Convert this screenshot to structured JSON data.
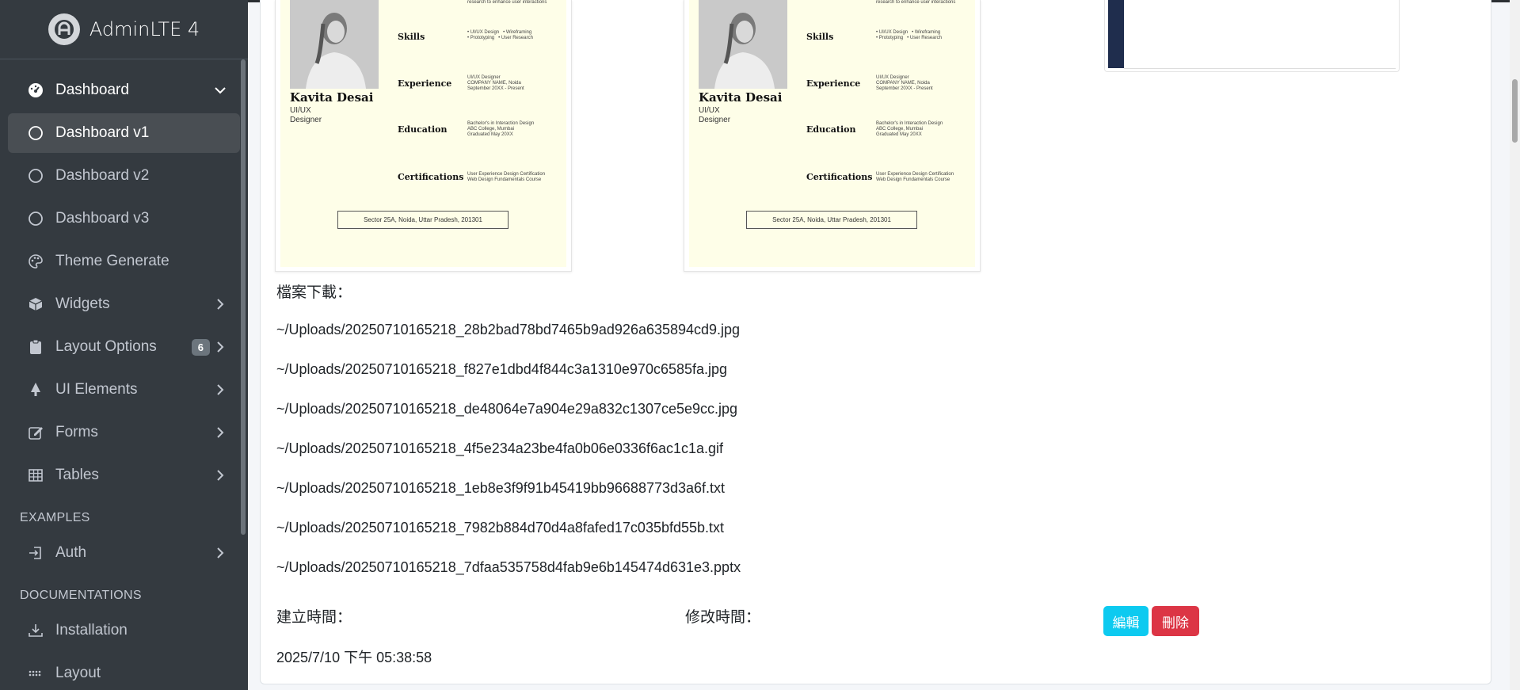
{
  "brand": {
    "name": "AdminLTE 4",
    "logo_icon": "adminlte-logo-icon"
  },
  "sidebar": {
    "items": [
      {
        "label": "Dashboard",
        "icon": "speedometer-icon",
        "chevron": "down"
      },
      {
        "label": "Dashboard v1",
        "icon": "circle-icon"
      },
      {
        "label": "Dashboard v2",
        "icon": "circle-icon"
      },
      {
        "label": "Dashboard v3",
        "icon": "circle-icon"
      },
      {
        "label": "Theme Generate",
        "icon": "palette-icon"
      },
      {
        "label": "Widgets",
        "icon": "box-icon",
        "chevron": "right"
      },
      {
        "label": "Layout Options",
        "icon": "clipboard-icon",
        "badge": "6",
        "chevron": "right"
      },
      {
        "label": "UI Elements",
        "icon": "tree-icon",
        "chevron": "right"
      },
      {
        "label": "Forms",
        "icon": "pencil-square-icon",
        "chevron": "right"
      },
      {
        "label": "Tables",
        "icon": "table-icon",
        "chevron": "right"
      }
    ],
    "header_examples": "EXAMPLES",
    "auth": {
      "label": "Auth",
      "icon": "login-icon"
    },
    "header_docs": "DOCUMENTATIONS",
    "installation": {
      "label": "Installation",
      "icon": "download-icon"
    },
    "layout": {
      "label": "Layout",
      "icon": "grip-icon"
    }
  },
  "resume": {
    "name": "Kavita Desai",
    "role": "UI/UX Designer",
    "top_text": "research to enhance user interactions",
    "skills_title": "Skills",
    "skills_text": "• UI/UX Design   • Wireframing\n• Prototyping   • User Research",
    "experience_title": "Experience",
    "experience_text": "UI/UX Designer\nCOMPANY NAME, Noida\nSeptember 20XX - Present",
    "education_title": "Education",
    "education_text": "Bachelor's in Interaction Design\nABC College, Mumbai\nGraduated May 20XX",
    "certifications_title": "Certifications",
    "certifications_text": "User Experience Design Certification\nWeb Design Fundamentals Course",
    "address": "Sector 25A, Noida, Uttar Pradesh, 201301"
  },
  "files": {
    "label": "檔案下載：",
    "items": [
      "~/Uploads/20250710165218_28b2bad78bd7465b9ad926a635894cd9.jpg",
      "~/Uploads/20250710165218_f827e1dbd4f844c3a1310e970c6585fa.jpg",
      "~/Uploads/20250710165218_de48064e7a904e29a832c1307ce5e9cc.jpg",
      "~/Uploads/20250710165218_4f5e234a23be4fa0b06e0336f6ac1c1a.gif",
      "~/Uploads/20250710165218_1eb8e3f9f91b45419bb96688773d3a6f.txt",
      "~/Uploads/20250710165218_7982b884d70d4a8fafed17c035bfd55b.txt",
      "~/Uploads/20250710165218_7dfaa535758d4fab9e6b145474d631e3.pptx"
    ]
  },
  "meta": {
    "created_label": "建立時間：",
    "modified_label": "修改時間：",
    "created_value": "2025/7/10 下午 05:38:58"
  },
  "actions": {
    "edit_label": "編輯",
    "delete_label": "刪除"
  },
  "colors": {
    "sidebar_bg": "#343a40",
    "edit_btn": "#0dcaf0",
    "delete_btn": "#dc3545"
  }
}
